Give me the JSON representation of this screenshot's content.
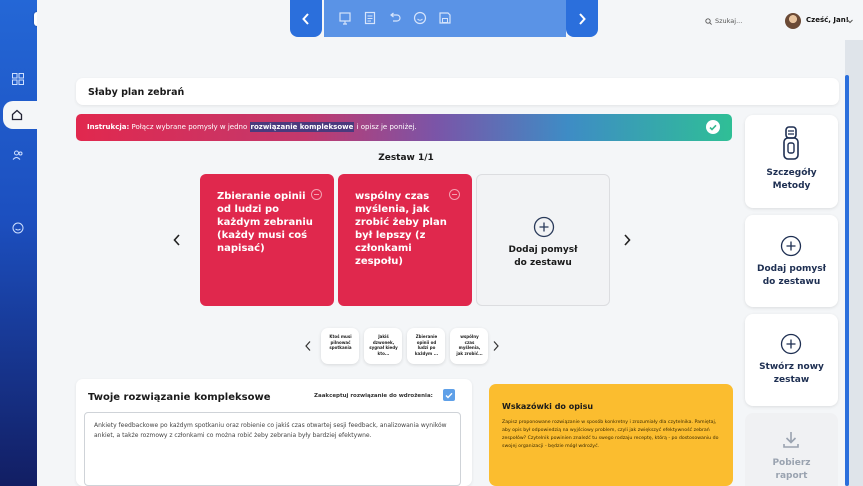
{
  "topbar": {
    "search_placeholder": "Szukaj...",
    "greeting": "Cześć, Jan!"
  },
  "page": {
    "title": "Słaby plan zebrań"
  },
  "instruction": {
    "label": "Instrukcja:",
    "text_before": " Połącz wybrane pomysły w jedno ",
    "highlight": "rozwiązanie kompleksowe",
    "text_after": " i opisz je poniżej."
  },
  "set": {
    "label": "Zestaw 1/1",
    "ideas": [
      "Zbieranie opinii od ludzi po każdym zebraniu (każdy musi coś napisać)",
      "wspólny czas myślenia, jak zrobić żeby plan był lepszy (z członkami zespołu)"
    ],
    "add_card_label": "Dodaj pomysł do zestawu"
  },
  "thumbnails": [
    "Ktoś musi pilnować spotkania",
    "Jakiś dzwonek, sygnał kiedy kto...",
    "Zbieranie opinii od ludzi po każdym ...",
    "wspólny czas myślenia, jak zrobić..."
  ],
  "side_actions": {
    "method_details": "Szczegóły Metody",
    "add_idea": "Dodaj pomysł do zestawu",
    "new_set": "Stwórz nowy zestaw",
    "download_report": "Pobierz raport"
  },
  "solution": {
    "title": "Twoje rozwiązanie kompleksowe",
    "accept_label": "Zaakceptuj rozwiązanie do wdrożenia:",
    "accepted": true,
    "text": "Ankiety feedbackowe po każdym spotkaniu oraz robienie co jakiś czas otwartej sesji feedback, analizowania wyników ankiet, a także rozmowy z członkami co można robić żeby zebrania były bardziej efektywne."
  },
  "tips": {
    "title": "Wskazówki do opisu",
    "text": "Zapisz proponowane rozwiązanie w sposób konkretny i zrozumiały dla czytelnika. Pamiętaj, aby opis był odpowiedzią na wyjściowy problem, czyli jak zwiększyć efektywność zebrań zespołów? Czytelnik powinien znaleźć tu swego rodzaju receptę, którą - po dostosowaniu do swojej organizacji - będzie mógł wdrożyć."
  },
  "colors": {
    "brand_blue": "#2b6fdc",
    "idea_red": "#e0284d",
    "tips_yellow": "#fbbd2f",
    "check_blue": "#5fa0e8"
  }
}
